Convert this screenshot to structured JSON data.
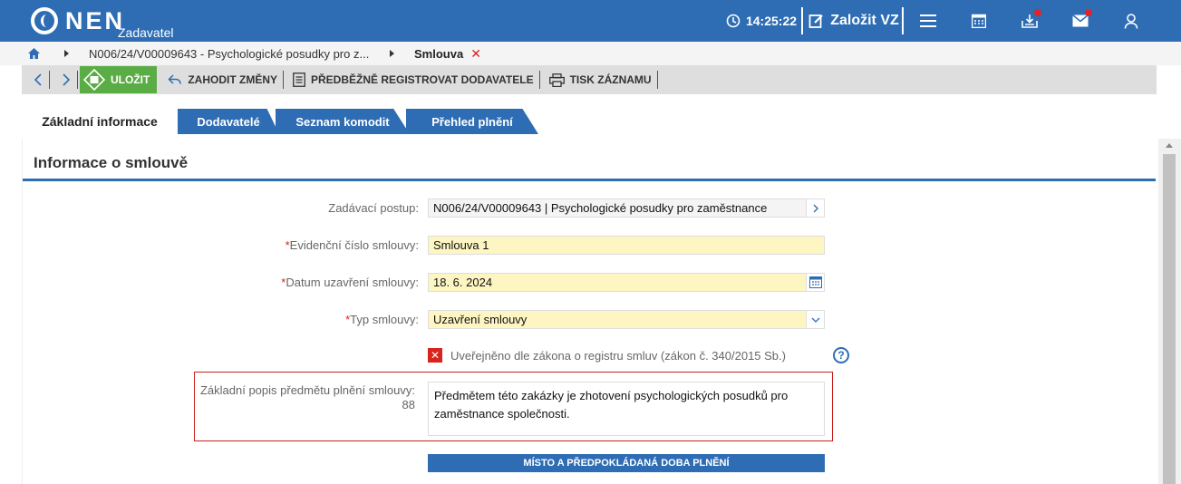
{
  "header": {
    "logo_text": "NEN",
    "logo_sub": "Zadavatel",
    "time": "14:25:22",
    "create_label": "Založit VZ",
    "color": "#2e6db4"
  },
  "breadcrumb": {
    "home_icon": "home-icon",
    "item1": "N006/24/V00009643 - Psychologické posudky pro z...",
    "item2": "Smlouva",
    "close": "✕"
  },
  "toolbar": {
    "save": "ULOŽIT",
    "discard": "ZAHODIT ZMĚNY",
    "preregister": "PŘEDBĚŽNĚ REGISTROVAT DODAVATELE",
    "print": "TISK ZÁZNAMU"
  },
  "tabs": [
    {
      "label": "Základní informace",
      "active": true
    },
    {
      "label": "Dodavatelé",
      "active": false
    },
    {
      "label": "Seznam komodit",
      "active": false
    },
    {
      "label": "Přehled plnění",
      "active": false
    }
  ],
  "panel": {
    "title": "Informace o smlouvě"
  },
  "form": {
    "procedure_label": "Zadávací postup:",
    "procedure_value": "N006/24/V00009643 | Psychologické posudky pro zaměstnance",
    "contract_no_label": "Evidenční číslo smlouvy:",
    "contract_no_value": "Smlouva 1",
    "date_label": "Datum uzavření smlouvy:",
    "date_value": "18. 6. 2024",
    "type_label": "Typ smlouvy:",
    "type_value": "Uzavření smlouvy",
    "published_label": "Uveřejněno dle zákona o registru smluv (zákon č. 340/2015 Sb.)",
    "description_label": "Základní popis předmětu plnění smlouvy:",
    "description_count": "88",
    "description_value": "Předmětem této zakázky je zhotovení psychologických posudků pro zaměstnance společnosti.",
    "place_button": "MÍSTO A PŘEDPOKLÁDANÁ DOBA PLNĚNÍ",
    "required_mark": "*",
    "help": "?"
  }
}
